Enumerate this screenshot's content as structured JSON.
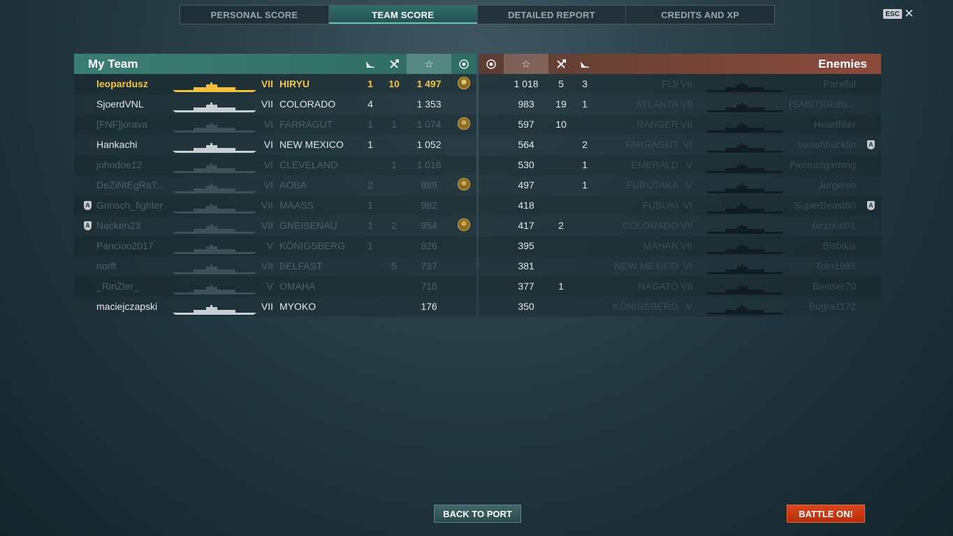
{
  "tabs": [
    {
      "label": "PERSONAL SCORE"
    },
    {
      "label": "TEAM SCORE"
    },
    {
      "label": "DETAILED REPORT"
    },
    {
      "label": "CREDITS AND XP"
    }
  ],
  "active_tab": "TEAM SCORE",
  "esc_label": "ESC",
  "colors": {
    "my_team": "#3b7d72",
    "enemies": "#8b4b3b",
    "player_highlight": "#f4c542",
    "battle_button": "#c73812"
  },
  "my_team": {
    "title": "My Team",
    "columns": [
      "planes-destroyed-icon",
      "frags-icon",
      "score-star-icon",
      "medal-icon"
    ],
    "rows": [
      {
        "name": "leopardusz",
        "tier": "VII",
        "ship": "HIRYU",
        "planes": "1",
        "frags": "10",
        "score": "1 497",
        "medal": true,
        "pin": false,
        "state": "player"
      },
      {
        "name": "SjoerdVNL",
        "tier": "VII",
        "ship": "COLORADO",
        "planes": "4",
        "frags": "",
        "score": "1 353",
        "medal": false,
        "pin": false,
        "state": "alive"
      },
      {
        "name": "[FNF]jorava",
        "tier": "VI",
        "ship": "FARRAGUT",
        "planes": "1",
        "frags": "1",
        "score": "1 074",
        "medal": true,
        "pin": false,
        "state": "dead"
      },
      {
        "name": "Hankachi",
        "tier": "VI",
        "ship": "NEW MEXICO",
        "planes": "1",
        "frags": "",
        "score": "1 052",
        "medal": false,
        "pin": false,
        "state": "alive"
      },
      {
        "name": "johndoe12",
        "tier": "VI",
        "ship": "CLEVELAND",
        "planes": "",
        "frags": "1",
        "score": "1 016",
        "medal": false,
        "pin": false,
        "state": "dead"
      },
      {
        "name": "DeZiNtEgRaT...",
        "tier": "VI",
        "ship": "AOBA",
        "planes": "2",
        "frags": "",
        "score": "989",
        "medal": true,
        "pin": false,
        "state": "dead"
      },
      {
        "name": "Grinsch_fighter",
        "tier": "VII",
        "ship": "MAASS",
        "planes": "1",
        "frags": "",
        "score": "982",
        "medal": false,
        "pin": true,
        "state": "dead"
      },
      {
        "name": "Nacken23",
        "tier": "VII",
        "ship": "GNEISENAU",
        "planes": "1",
        "frags": "2",
        "score": "954",
        "medal": true,
        "pin": true,
        "state": "dead"
      },
      {
        "name": "Pancioo2017",
        "tier": "V",
        "ship": "KÖNIGSBERG",
        "planes": "1",
        "frags": "",
        "score": "926",
        "medal": false,
        "pin": false,
        "state": "dead"
      },
      {
        "name": "norft",
        "tier": "VII",
        "ship": "BELFAST",
        "planes": "",
        "frags": "5",
        "score": "737",
        "medal": false,
        "pin": false,
        "state": "dead"
      },
      {
        "name": "_RinZler_",
        "tier": "V",
        "ship": "OMAHA",
        "planes": "",
        "frags": "",
        "score": "718",
        "medal": false,
        "pin": false,
        "state": "dead"
      },
      {
        "name": "maciejczapski",
        "tier": "VII",
        "ship": "MYOKO",
        "planes": "",
        "frags": "",
        "score": "176",
        "medal": false,
        "pin": false,
        "state": "alive"
      }
    ]
  },
  "enemies": {
    "title": "Enemies",
    "columns": [
      "medal-icon",
      "score-star-icon",
      "frags-icon",
      "planes-destroyed-icon"
    ],
    "rows": [
      {
        "score": "1 018",
        "frags": "5",
        "planes": "3",
        "ship": "FIJI",
        "tier": "VII",
        "name": "Parxifal",
        "pin": false
      },
      {
        "score": "983",
        "frags": "19",
        "planes": "1",
        "ship": "ATLANTA",
        "tier": "VII",
        "name": "[SABIT]Giulia...",
        "pin": false
      },
      {
        "score": "597",
        "frags": "10",
        "planes": "",
        "ship": "RANGER",
        "tier": "VII",
        "name": "Heartfiller",
        "pin": false
      },
      {
        "score": "564",
        "frags": "",
        "planes": "2",
        "ship": "FARRAGUT",
        "tier": "VI",
        "name": "swashbucklin",
        "pin": true
      },
      {
        "score": "530",
        "frags": "",
        "planes": "1",
        "ship": "EMERALD",
        "tier": "V",
        "name": "Pierrootgaming",
        "pin": false
      },
      {
        "score": "497",
        "frags": "",
        "planes": "1",
        "ship": "FURUTAKA",
        "tier": "V",
        "name": "Jurgenio",
        "pin": false
      },
      {
        "score": "418",
        "frags": "",
        "planes": "",
        "ship": "FUBUKI",
        "tier": "VI",
        "name": "SuperBeast80",
        "pin": true
      },
      {
        "score": "417",
        "frags": "2",
        "planes": "",
        "ship": "COLORADO",
        "tier": "VII",
        "name": "farzoun01",
        "pin": false
      },
      {
        "score": "395",
        "frags": "",
        "planes": "",
        "ship": "MAHAN",
        "tier": "VII",
        "name": "Bisbikis",
        "pin": false
      },
      {
        "score": "381",
        "frags": "",
        "planes": "",
        "ship": "NEW MEXICO",
        "tier": "VI",
        "name": "Toto1985",
        "pin": false
      },
      {
        "score": "377",
        "frags": "1",
        "planes": "",
        "ship": "NAGATO",
        "tier": "VII",
        "name": "Beisser70",
        "pin": false
      },
      {
        "score": "350",
        "frags": "",
        "planes": "",
        "ship": "KÖNIGSBERG",
        "tier": "V",
        "name": "Bugra1172",
        "pin": false
      }
    ]
  },
  "buttons": {
    "back_to_port": "BACK TO PORT",
    "battle_on": "BATTLE ON!"
  }
}
